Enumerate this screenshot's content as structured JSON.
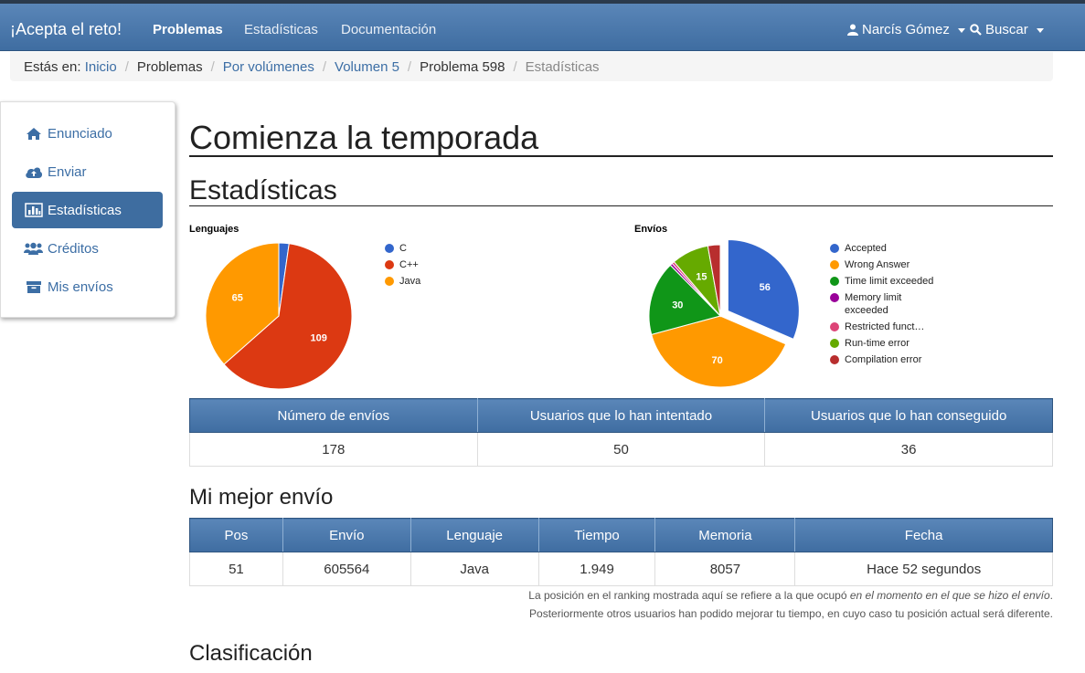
{
  "nav": {
    "brand": "¡Acepta el reto!",
    "links": [
      "Problemas",
      "Estadísticas",
      "Documentación"
    ],
    "user": "Narcís Gómez",
    "search": "Buscar"
  },
  "breadcrumb": {
    "prefix": "Estás en:",
    "items": [
      "Inicio",
      "Problemas",
      "Por volúmenes",
      "Volumen 5",
      "Problema 598",
      "Estadísticas"
    ]
  },
  "sidebar": {
    "items": [
      "Enunciado",
      "Enviar",
      "Estadísticas",
      "Créditos",
      "Mis envíos"
    ]
  },
  "main": {
    "title": "Comienza la temporada",
    "stats_heading": "Estadísticas",
    "best_heading": "Mi mejor envío",
    "ranking_heading": "Clasificación"
  },
  "chart_data": [
    {
      "type": "pie",
      "title": "Lenguajes",
      "categories": [
        "C",
        "C++",
        "Java"
      ],
      "values": [
        4,
        109,
        65
      ],
      "colors": [
        "#3366cc",
        "#dc3912",
        "#ff9900"
      ]
    },
    {
      "type": "pie",
      "title": "Envíos",
      "categories": [
        "Accepted",
        "Wrong Answer",
        "Time limit exceeded",
        "Memory limit exceeded",
        "Restricted funct…",
        "Run-time error",
        "Compilation error"
      ],
      "values": [
        56,
        70,
        30,
        1,
        1,
        15,
        5
      ],
      "colors": [
        "#3366cc",
        "#ff9900",
        "#109618",
        "#990099",
        "#dd4477",
        "#66aa00",
        "#b82e2e"
      ]
    }
  ],
  "summary_table": {
    "headers": [
      "Número de envíos",
      "Usuarios que lo han intentado",
      "Usuarios que lo han conseguido"
    ],
    "row": [
      "178",
      "50",
      "36"
    ]
  },
  "best_table": {
    "headers": [
      "Pos",
      "Envío",
      "Lenguaje",
      "Tiempo",
      "Memoria",
      "Fecha"
    ],
    "row": [
      "51",
      "605564",
      "Java",
      "1.949",
      "8057",
      "Hace 52 segundos"
    ]
  },
  "notes": {
    "line1_a": "La posición en el ranking mostrada aquí se refiere a la que ocupó ",
    "line1_b": "en el momento en el que se hizo el envío",
    "line1_c": ".",
    "line2": "Posteriormente otros usuarios han podido mejorar tu tiempo, en cuyo caso tu posición actual será diferente."
  }
}
